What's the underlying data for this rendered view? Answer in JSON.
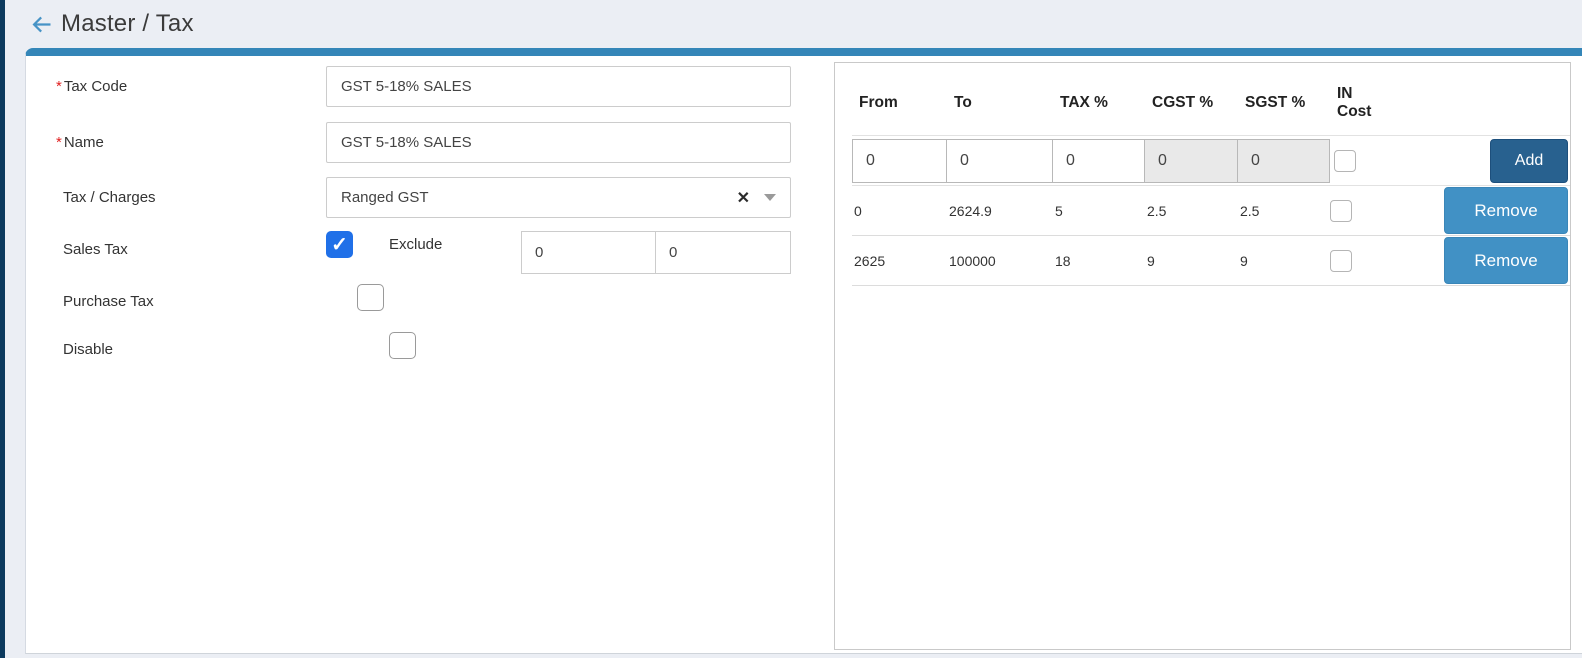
{
  "header": {
    "title": "Master / Tax",
    "back_icon": "arrow-left"
  },
  "form": {
    "required_marker": "*",
    "fields": {
      "tax_code": {
        "label": "Tax Code",
        "required": true,
        "value": "GST 5-18% SALES"
      },
      "name": {
        "label": "Name",
        "required": true,
        "value": "GST 5-18% SALES"
      },
      "tax_charges": {
        "label": "Tax / Charges",
        "value": "Ranged GST",
        "clear_icon": "✕",
        "dropdown_icon": "caret-down"
      },
      "sales_tax": {
        "label": "Sales Tax",
        "checked": true,
        "exclude_label": "Exclude",
        "exclude_from": "0",
        "exclude_to": "0"
      },
      "purchase_tax": {
        "label": "Purchase Tax",
        "checked": false
      },
      "disable": {
        "label": "Disable",
        "checked": false
      }
    }
  },
  "slab_table": {
    "columns": [
      "From",
      "To",
      "TAX %",
      "CGST %",
      "SGST %",
      "IN Cost"
    ],
    "new_row": {
      "from": "0",
      "to": "0",
      "tax": "0",
      "cgst": "0",
      "sgst": "0",
      "cgst_disabled": true,
      "sgst_disabled": true,
      "in_cost_checked": false,
      "add_label": "Add"
    },
    "rows": [
      {
        "from": "0",
        "to": "2624.9",
        "tax": "5",
        "cgst": "2.5",
        "sgst": "2.5",
        "in_cost_checked": false,
        "remove_label": "Remove"
      },
      {
        "from": "2625",
        "to": "100000",
        "tax": "18",
        "cgst": "9",
        "sgst": "9",
        "in_cost_checked": false,
        "remove_label": "Remove"
      }
    ]
  },
  "colors": {
    "accent_bar": "#3486b8",
    "left_strip": "#0c3a5e",
    "topbar_bg": "#ebeef4",
    "back_arrow": "#4793c6",
    "required": "#e02020",
    "checkbox_checked": "#2070e8",
    "add_button": "#28618f",
    "remove_button": "#4191c5",
    "disabled_cell_bg": "#e9e9e9"
  }
}
